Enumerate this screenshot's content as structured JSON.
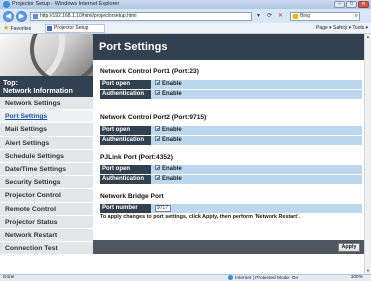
{
  "window": {
    "title": "Projector Setup - Windows Internet Explorer",
    "minimize": "–",
    "maximize": "□",
    "close": "✕"
  },
  "addressbar": {
    "url": "http://192.168.1.10/html/projectorsetup.html",
    "search_placeholder": "Bing",
    "back": "◀",
    "forward": "▶"
  },
  "favorites": {
    "label": "Favorites",
    "tab": "Projector Setup",
    "commands": "Page ▾  Safety ▾  Tools ▾"
  },
  "sidebar": {
    "topic_line1": "Top:",
    "topic_line2": "Network Information",
    "items": [
      {
        "label": "Network Settings"
      },
      {
        "label": "Port Settings"
      },
      {
        "label": "Mail Settings"
      },
      {
        "label": "Alert Settings"
      },
      {
        "label": "Schedule Settings"
      },
      {
        "label": "Date/Time Settings"
      },
      {
        "label": "Security Settings"
      },
      {
        "label": "Projector Control"
      },
      {
        "label": "Remote Control"
      },
      {
        "label": "Projector Status"
      },
      {
        "label": "Network Restart"
      },
      {
        "label": "Connection Test"
      }
    ],
    "active_index": 1
  },
  "main": {
    "title": "Port Settings",
    "sections": [
      {
        "title": "Network Control Port1 (Port:23)",
        "rows": [
          {
            "label": "Port open",
            "value": "Enable",
            "checked": true
          },
          {
            "label": "Authentication",
            "value": "Enable",
            "checked": true
          }
        ]
      },
      {
        "title": "Network Control Port2 (Port:9715)",
        "rows": [
          {
            "label": "Port open",
            "value": "Enable",
            "checked": true
          },
          {
            "label": "Authentication",
            "value": "Enable",
            "checked": true
          }
        ]
      },
      {
        "title": "PJLink Port (Port:4352)",
        "rows": [
          {
            "label": "Port open",
            "value": "Enable",
            "checked": true
          },
          {
            "label": "Authentication",
            "value": "Enable",
            "checked": true
          }
        ]
      }
    ],
    "bridge": {
      "title": "Network Bridge Port",
      "label": "Port number",
      "value": "9717"
    },
    "note": "To apply changes to port settings, click Apply, then perform 'Network Restart'.",
    "apply_label": "Apply"
  },
  "statusbar": {
    "left": "Done",
    "zone": "Internet | Protected Mode: On",
    "zoom": "100%"
  },
  "colors": {
    "header_bg": "#33404f",
    "row_bg": "#bdd7ee",
    "sidebar_item_bg": "#e3e5e8",
    "active_link": "#1d4fa0"
  }
}
